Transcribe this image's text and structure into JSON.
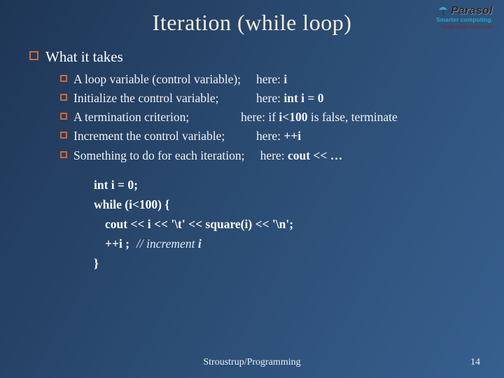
{
  "title": "Iteration (while loop)",
  "top_bullet": "What it takes",
  "items": [
    {
      "text": "A loop variable (control variable);",
      "here_prefix": "here: ",
      "here_bold": "i",
      "here_suffix": ""
    },
    {
      "text": "Initialize the control variable;",
      "here_prefix": "here: ",
      "here_bold": "int i = 0",
      "here_suffix": ""
    },
    {
      "text": "A termination criterion;",
      "here_prefix": "here: if ",
      "here_bold": "i<100",
      "here_suffix": " is false, terminate"
    },
    {
      "text": "Increment the control variable;",
      "here_prefix": "here: ",
      "here_bold": "++i",
      "here_suffix": ""
    },
    {
      "text": "Something to do for each iteration;",
      "here_prefix": "   here: ",
      "here_bold": "cout << …",
      "here_suffix": ""
    }
  ],
  "code": {
    "l1": "int i = 0;",
    "l2": "while (i<100)  {",
    "l3": "cout  << i << '\\t' << square(i) << '\\n';",
    "l4a": "++i ;",
    "l4b": "// increment",
    "l4c": " i",
    "l5": "}"
  },
  "footer": {
    "center": "Stroustrup/Programming",
    "page": "14"
  },
  "logo": {
    "brand": "Parasol",
    "tag": "Smarter computing.",
    "univ": "Texas A&M University"
  }
}
